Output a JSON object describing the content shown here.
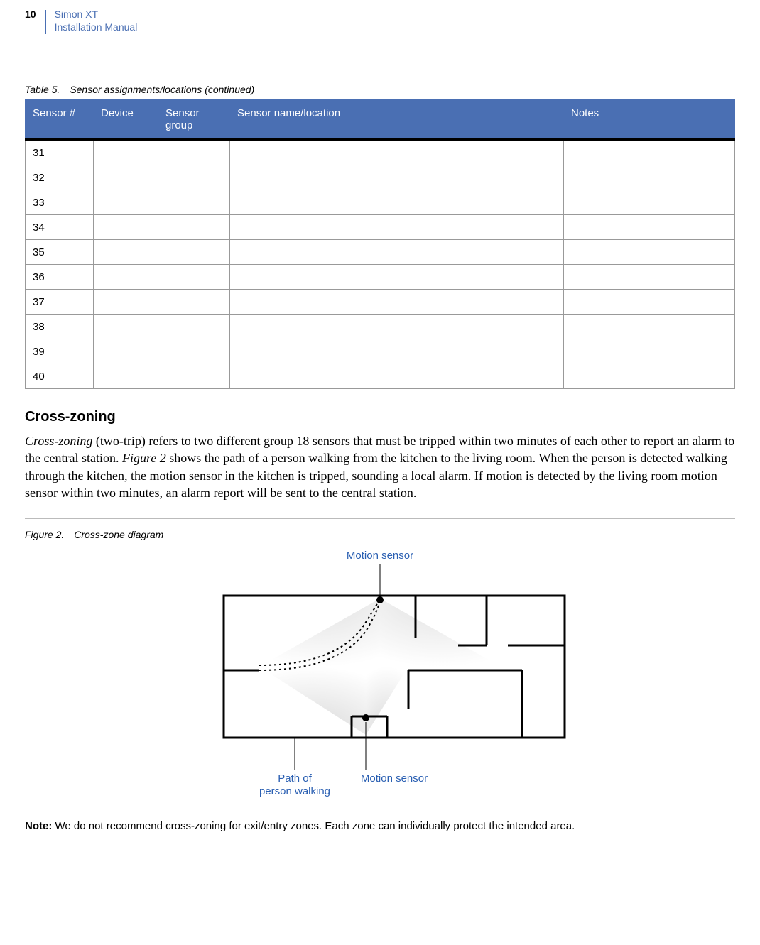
{
  "header": {
    "pagenum": "10",
    "title1": "Simon XT",
    "title2": "Installation Manual"
  },
  "table": {
    "caption_num": "Table 5.",
    "caption_text": "Sensor assignments/locations (continued)",
    "headers": {
      "sensor": "Sensor #",
      "device": "Device",
      "group": "Sensor group",
      "name": "Sensor name/location",
      "notes": "Notes"
    },
    "rows": [
      {
        "sensor": "31",
        "device": "",
        "group": "",
        "name": "",
        "notes": ""
      },
      {
        "sensor": "32",
        "device": "",
        "group": "",
        "name": "",
        "notes": ""
      },
      {
        "sensor": "33",
        "device": "",
        "group": "",
        "name": "",
        "notes": ""
      },
      {
        "sensor": "34",
        "device": "",
        "group": "",
        "name": "",
        "notes": ""
      },
      {
        "sensor": "35",
        "device": "",
        "group": "",
        "name": "",
        "notes": ""
      },
      {
        "sensor": "36",
        "device": "",
        "group": "",
        "name": "",
        "notes": ""
      },
      {
        "sensor": "37",
        "device": "",
        "group": "",
        "name": "",
        "notes": ""
      },
      {
        "sensor": "38",
        "device": "",
        "group": "",
        "name": "",
        "notes": ""
      },
      {
        "sensor": "39",
        "device": "",
        "group": "",
        "name": "",
        "notes": ""
      },
      {
        "sensor": "40",
        "device": "",
        "group": "",
        "name": "",
        "notes": ""
      }
    ]
  },
  "section": {
    "heading": "Cross-zoning",
    "para_prefix_em": "Cross-zoning",
    "para_rest": " (two-trip) refers to two different group 18 sensors that must be tripped within two minutes of each other to report an alarm to the central station. ",
    "para_fig_em": "Figure 2",
    "para_after_fig": " shows the path of a person walking from the kitchen to the living room. When the person is detected walking through the kitchen, the motion sensor in the kitchen is tripped, sounding a local alarm. If motion is detected by the living room motion sensor within two minutes, an alarm report will be sent to the central station."
  },
  "figure": {
    "caption_num": "Figure 2.",
    "caption_text": "Cross-zone diagram",
    "label_top": "Motion sensor",
    "label_bottom_left_line1": "Path of",
    "label_bottom_left_line2": "person walking",
    "label_bottom_right": "Motion sensor"
  },
  "note": {
    "label": "Note:",
    "text": "  We do not recommend cross-zoning for exit/entry zones. Each zone can individually protect the intended area."
  }
}
